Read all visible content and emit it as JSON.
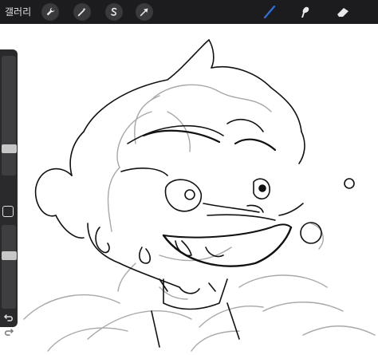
{
  "toolbar": {
    "gallery_label": "갤러리",
    "left_tools": [
      "wrench-icon",
      "magic-wand-icon",
      "selection-s-icon",
      "arrow-transform-icon"
    ],
    "right_tools": [
      "brush-icon",
      "smudge-icon",
      "eraser-icon"
    ],
    "active_tool": "brush-icon",
    "active_color": "#2f6fe0"
  },
  "sidebar": {
    "brush_size": 0.2,
    "opacity": 0.65
  },
  "colors": {
    "toolbar_bg": "#1c1c1e",
    "sketch_dark": "#111111",
    "sketch_light": "#a8a8a8"
  }
}
